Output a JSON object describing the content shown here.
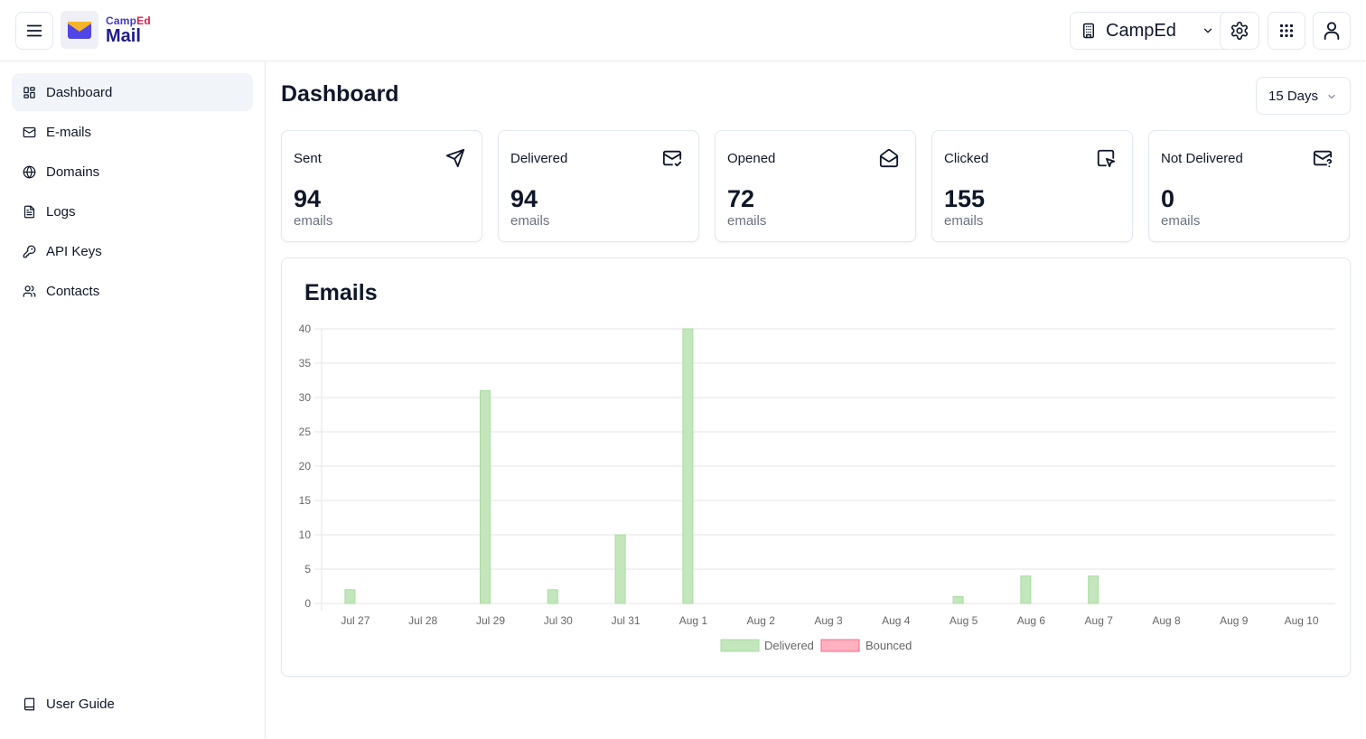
{
  "header": {
    "menu_icon": "hamburger-menu-icon",
    "logo": {
      "top_part1": "Camp",
      "top_part2": "Ed",
      "bottom": "Mail",
      "icon": "envelope-logo-icon"
    },
    "org_selector": {
      "value": "CampEd",
      "icon": "building-icon"
    },
    "settings_icon": "gear-icon",
    "apps_icon": "grid-dots-icon",
    "user_icon": "user-icon"
  },
  "sidebar": {
    "items": [
      {
        "label": "Dashboard",
        "icon": "dashboard-icon",
        "active": true
      },
      {
        "label": "E-mails",
        "icon": "mail-icon",
        "active": false
      },
      {
        "label": "Domains",
        "icon": "globe-icon",
        "active": false
      },
      {
        "label": "Logs",
        "icon": "file-text-icon",
        "active": false
      },
      {
        "label": "API Keys",
        "icon": "key-icon",
        "active": false
      },
      {
        "label": "Contacts",
        "icon": "users-icon",
        "active": false
      }
    ],
    "footer": {
      "label": "User Guide",
      "icon": "book-icon"
    }
  },
  "main": {
    "title": "Dashboard",
    "range_select": {
      "value": "15 Days"
    },
    "stats": [
      {
        "title": "Sent",
        "value": "94",
        "unit": "emails",
        "icon": "send-icon"
      },
      {
        "title": "Delivered",
        "value": "94",
        "unit": "emails",
        "icon": "mail-check-icon"
      },
      {
        "title": "Opened",
        "value": "72",
        "unit": "emails",
        "icon": "mail-open-icon"
      },
      {
        "title": "Clicked",
        "value": "155",
        "unit": "emails",
        "icon": "pointer-click-icon"
      },
      {
        "title": "Not Delivered",
        "value": "0",
        "unit": "emails",
        "icon": "mail-question-icon"
      }
    ],
    "chart_title": "Emails"
  },
  "colors": {
    "delivered_fill": "#c3e6bd",
    "delivered_stroke": "#a6dc9d",
    "bounced_fill": "#ffb1c1",
    "bounced_stroke": "#ff6384",
    "grid": "#e5e5e5",
    "logo_accent": "#4338ca",
    "logo_ed": "#e11d48"
  },
  "chart_data": {
    "type": "bar",
    "title": "Emails",
    "categories": [
      "Jul 27",
      "Jul 28",
      "Jul 29",
      "Jul 30",
      "Jul 31",
      "Aug 1",
      "Aug 2",
      "Aug 3",
      "Aug 4",
      "Aug 5",
      "Aug 6",
      "Aug 7",
      "Aug 8",
      "Aug 9",
      "Aug 10"
    ],
    "series": [
      {
        "name": "Delivered",
        "values": [
          2,
          0,
          31,
          2,
          10,
          40,
          0,
          0,
          0,
          1,
          4,
          4,
          0,
          0,
          0
        ]
      },
      {
        "name": "Bounced",
        "values": [
          0,
          0,
          0,
          0,
          0,
          0,
          0,
          0,
          0,
          0,
          0,
          0,
          0,
          0,
          0
        ]
      }
    ],
    "yticks": [
      0,
      5,
      10,
      15,
      20,
      25,
      30,
      35,
      40
    ],
    "ylim": [
      0,
      40
    ],
    "xlabel": "",
    "ylabel": "",
    "grid": true,
    "legend": "bottom-center"
  }
}
